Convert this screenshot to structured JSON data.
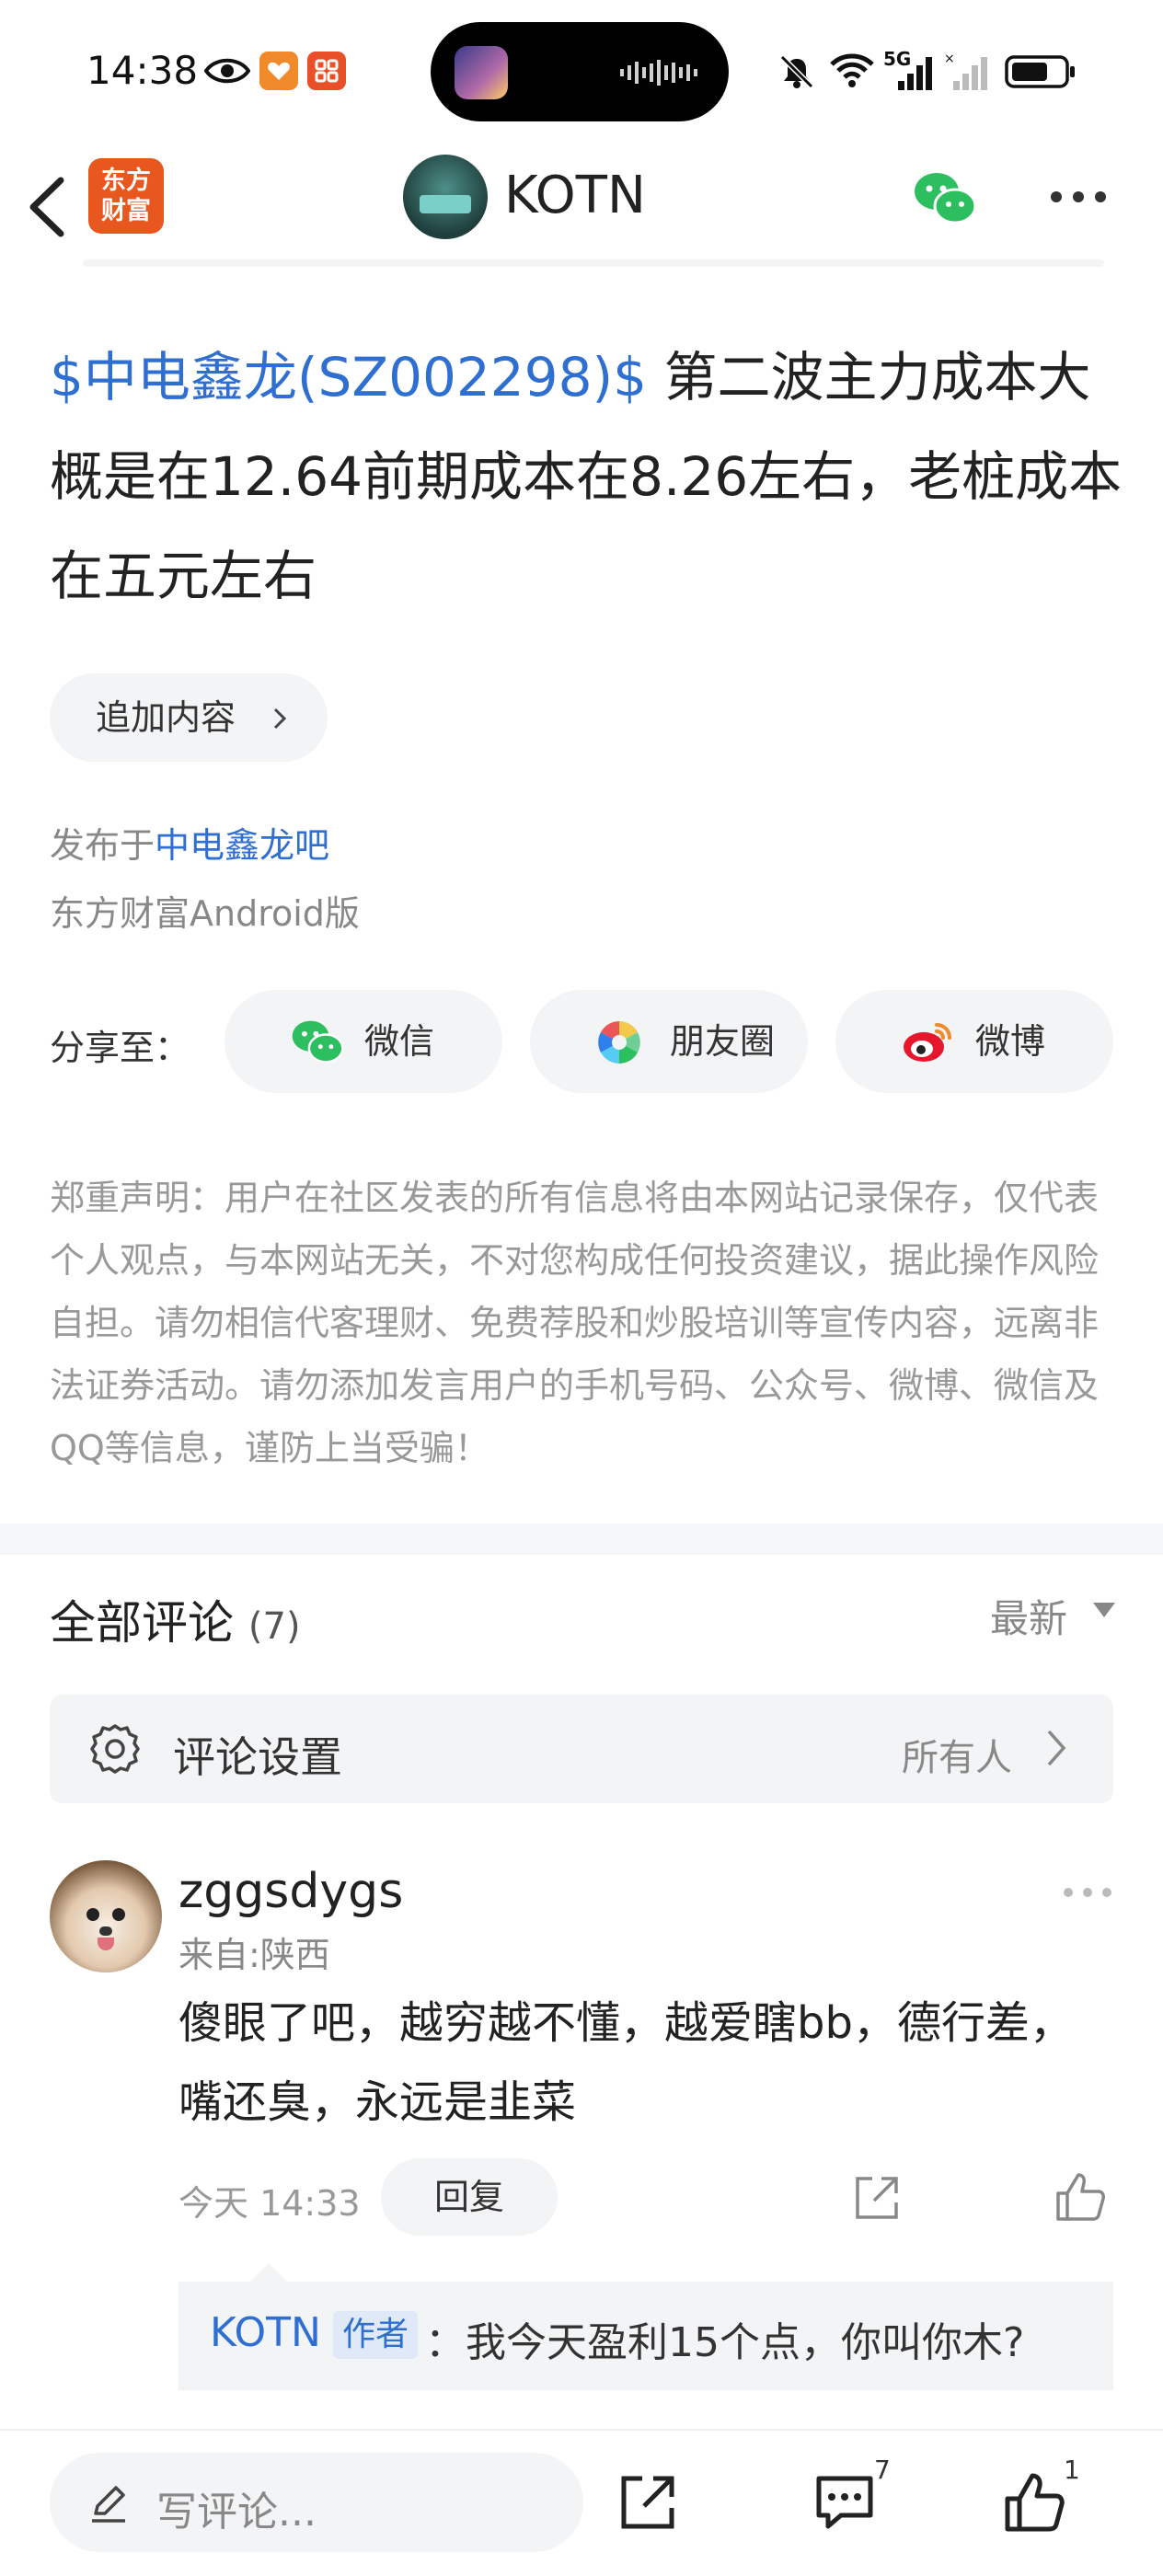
{
  "status_bar": {
    "time": "14:38",
    "network": "5G"
  },
  "header": {
    "app_logo_line1": "东方",
    "app_logo_line2": "财富",
    "username": "KOTN"
  },
  "post": {
    "stock_tag": "$中电鑫龙(SZ002298)$",
    "text": "第二波主力成本大概是在12.64前期成本在8.26左右，老桩成本在五元左右",
    "add_content_label": "追加内容",
    "published_prefix": "发布于",
    "published_bar": "中电鑫龙吧",
    "client": "东方财富Android版"
  },
  "share": {
    "label": "分享至：",
    "wechat": "微信",
    "moments": "朋友圈",
    "weibo": "微博"
  },
  "disclaimer": "郑重声明：用户在社区发表的所有信息将由本网站记录保存，仅代表个人观点，与本网站无关，不对您构成任何投资建议，据此操作风险自担。请勿相信代客理财、免费荐股和炒股培训等宣传内容，远离非法证券活动。请勿添加发言用户的手机号码、公众号、微博、微信及QQ等信息，谨防上当受骗！",
  "comments_header": {
    "title": "全部评论",
    "count": "(7)",
    "sort": "最新"
  },
  "comment_settings": {
    "label": "评论设置",
    "value": "所有人"
  },
  "comment": {
    "username": "zggsdygs",
    "location": "来自:陕西",
    "text": "傻眼了吧，越穷越不懂，越爱瞎bb，德行差，嘴还臭，永远是韭菜",
    "time": "今天 14:33",
    "reply_label": "回复",
    "reply": {
      "username": "KOTN",
      "badge": "作者",
      "text": "：我今天盈利15个点，你叫你木?"
    }
  },
  "bottom_bar": {
    "input_placeholder": "写评论...",
    "comment_count": "7",
    "like_count": "1"
  },
  "colors": {
    "link_blue": "#2f6fd1",
    "wechat_green": "#2dbe60",
    "brand_orange": "#e8581e"
  }
}
